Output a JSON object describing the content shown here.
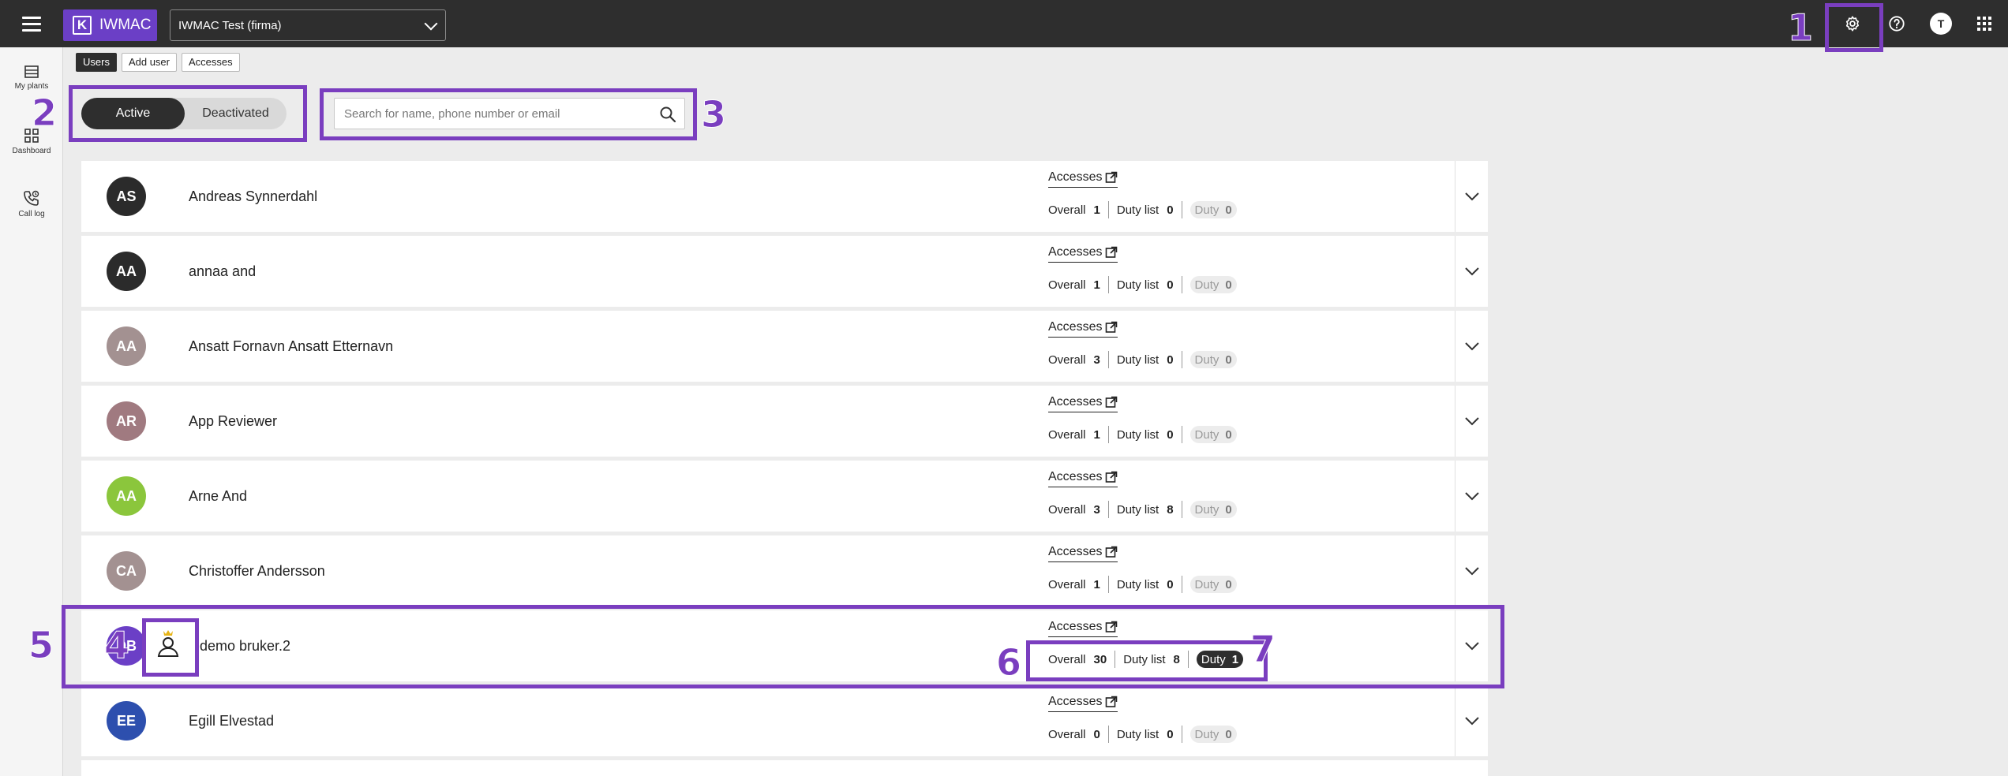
{
  "app": {
    "brand": "IWMAC",
    "company": "IWMAC Test (firma)",
    "avatar_initial": "T"
  },
  "sidebar": {
    "items": [
      {
        "label": "My plants",
        "icon": "list-icon"
      },
      {
        "label": "Dashboard",
        "icon": "dashboard-icon"
      },
      {
        "label": "Call log",
        "icon": "call-log-icon"
      }
    ]
  },
  "nav_tabs": [
    "Users",
    "Add user",
    "Accesses"
  ],
  "status_toggle": {
    "active": "Active",
    "deactivated": "Deactivated"
  },
  "search": {
    "placeholder": "Search for name, phone number or email"
  },
  "count_labels": {
    "overall": "Overall",
    "duty_list": "Duty list",
    "duty": "Duty",
    "accesses": "Accesses"
  },
  "annotations": [
    "1",
    "2",
    "3",
    "4",
    "5",
    "6",
    "7"
  ],
  "users": [
    {
      "initials": "AS",
      "name": "Andreas Synnerdahl",
      "color": "#2b2b2b",
      "overall": "1",
      "duty_list": "0",
      "duty": "0",
      "duty_active": false
    },
    {
      "initials": "AA",
      "name": "annaa and",
      "color": "#2b2b2b",
      "overall": "1",
      "duty_list": "0",
      "duty": "0",
      "duty_active": false
    },
    {
      "initials": "AA",
      "name": "Ansatt Fornavn Ansatt Etternavn",
      "color": "#a39191",
      "overall": "3",
      "duty_list": "0",
      "duty": "0",
      "duty_active": false
    },
    {
      "initials": "AR",
      "name": "App Reviewer",
      "color": "#a07a80",
      "overall": "1",
      "duty_list": "0",
      "duty": "0",
      "duty_active": false
    },
    {
      "initials": "AA",
      "name": "Arne And",
      "color": "#8bc63c",
      "overall": "3",
      "duty_list": "8",
      "duty": "0",
      "duty_active": false
    },
    {
      "initials": "CA",
      "name": "Christoffer Andersson",
      "color": "#a39191",
      "overall": "1",
      "duty_list": "0",
      "duty": "0",
      "duty_active": false
    },
    {
      "initials": "DB",
      "name": "demo bruker.2",
      "color": "#6b3fc6",
      "overall": "30",
      "duty_list": "8",
      "duty": "1",
      "duty_active": true,
      "admin": true
    },
    {
      "initials": "EE",
      "name": "Egill Elvestad",
      "color": "#2d4fae",
      "overall": "0",
      "duty_list": "0",
      "duty": "0",
      "duty_active": false
    }
  ]
}
